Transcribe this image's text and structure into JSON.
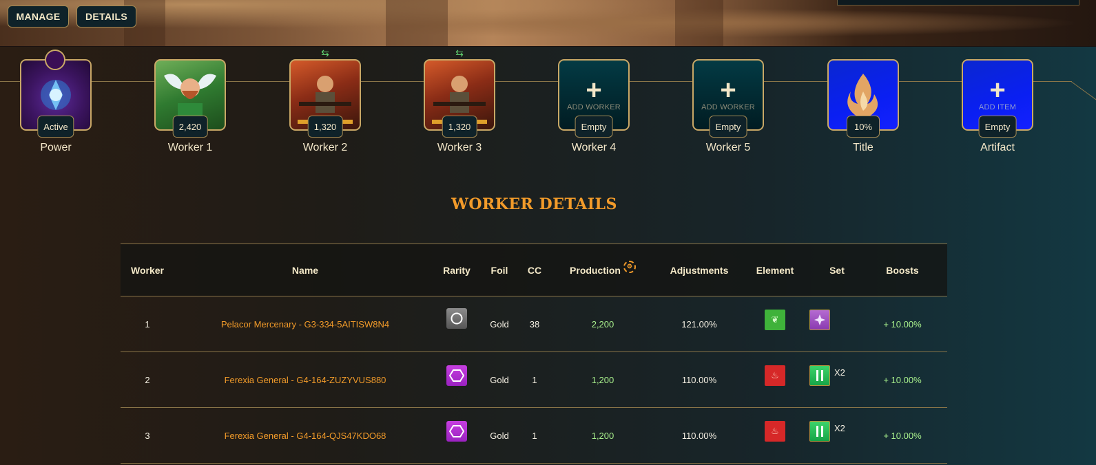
{
  "top_buttons": {
    "manage": "MANAGE",
    "details": "DETAILS"
  },
  "slots": [
    {
      "label": "Power",
      "badge": "Active",
      "type": "power"
    },
    {
      "label": "Worker 1",
      "badge": "2,420",
      "type": "hero-green"
    },
    {
      "label": "Worker 2",
      "badge": "1,320",
      "type": "hero-fire",
      "swap": "⇆"
    },
    {
      "label": "Worker 3",
      "badge": "1,320",
      "type": "hero-fire",
      "swap": "⇆"
    },
    {
      "label": "Worker 4",
      "badge": "Empty",
      "type": "empty",
      "add_text": "ADD WORKER"
    },
    {
      "label": "Worker 5",
      "badge": "Empty",
      "type": "empty",
      "add_text": "ADD WORKER"
    },
    {
      "label": "Title",
      "badge": "10%",
      "type": "blue"
    },
    {
      "label": "Artifact",
      "badge": "Empty",
      "type": "blue",
      "add_text": "ADD ITEM"
    }
  ],
  "section_title": "WORKER DETAILS",
  "table": {
    "headers": {
      "worker": "Worker",
      "name": "Name",
      "rarity": "Rarity",
      "foil": "Foil",
      "cc": "CC",
      "production": "Production",
      "adjustments": "Adjustments",
      "element": "Element",
      "set": "Set",
      "boosts": "Boosts"
    },
    "rows": [
      {
        "worker": "1",
        "name": "Pelacor Mercenary - G3-334-5AITISW8N4",
        "rarity": "common-circle",
        "foil": "Gold",
        "cc": "38",
        "production": "2,200",
        "adjustments": "121.00%",
        "element": "earth",
        "set": "purple-set",
        "set_mult": "",
        "boosts": "+ 10.00%"
      },
      {
        "worker": "2",
        "name": "Ferexia General - G4-164-ZUZYVUS880",
        "rarity": "epic-hexagon",
        "foil": "Gold",
        "cc": "1",
        "production": "1,200",
        "adjustments": "110.00%",
        "element": "fire",
        "set": "green-set",
        "set_mult": "X2",
        "boosts": "+ 10.00%"
      },
      {
        "worker": "3",
        "name": "Ferexia General - G4-164-QJS47KDO68",
        "rarity": "epic-hexagon",
        "foil": "Gold",
        "cc": "1",
        "production": "1,200",
        "adjustments": "110.00%",
        "element": "fire",
        "set": "green-set",
        "set_mult": "X2",
        "boosts": "+ 10.00%"
      }
    ]
  }
}
